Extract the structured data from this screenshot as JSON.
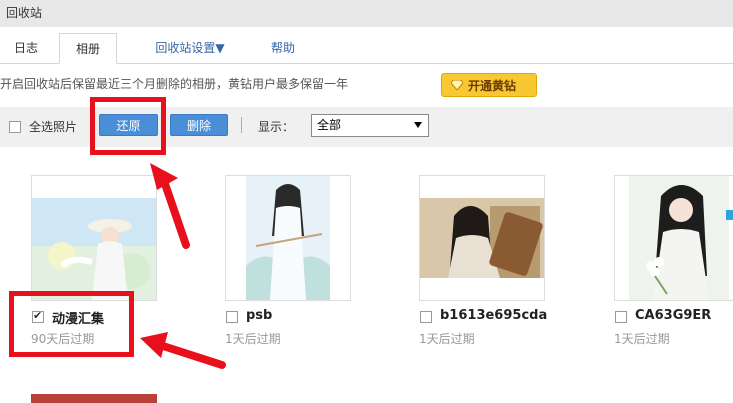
{
  "window": {
    "title": "回收站"
  },
  "tabs": [
    {
      "label": "日志"
    },
    {
      "label": "相册"
    },
    {
      "label": "回收站设置▼"
    },
    {
      "label": "帮助"
    }
  ],
  "notice": {
    "text": "开启回收站后保留最近三个月删除的相册，黄钻用户最多保留一年",
    "vip_button": "开通黄钻"
  },
  "toolbar": {
    "select_all_label": "全选照片",
    "restore_label": "还原",
    "delete_label": "删除",
    "display_label": "显示：",
    "display_value": "全部"
  },
  "albums": [
    {
      "name": "动漫汇集",
      "expire": "90天后过期",
      "checked": true
    },
    {
      "name": "psb",
      "expire": "1天后过期",
      "checked": false
    },
    {
      "name": "b1613e695cda",
      "expire": "1天后过期",
      "checked": false
    },
    {
      "name": "CA63G9ER",
      "expire": "1天后过期",
      "checked": false
    }
  ],
  "colors": {
    "accent_blue": "#4a8ed8",
    "vip_yellow": "#f7c832",
    "annotation_red": "#e8101a"
  }
}
